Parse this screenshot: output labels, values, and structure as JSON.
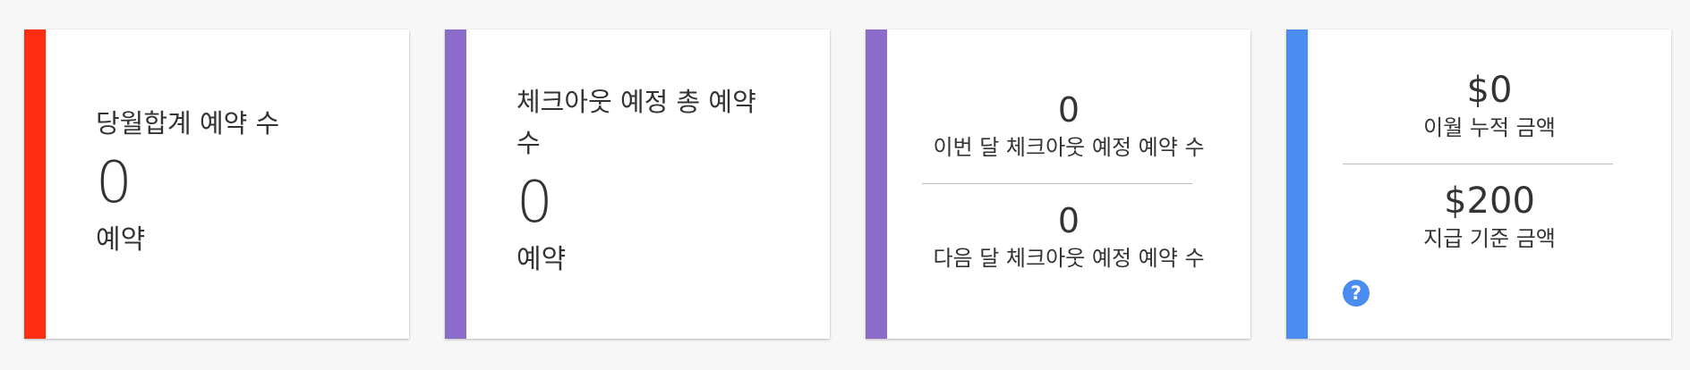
{
  "colors": {
    "card1_accent": "#ff2e12",
    "card2_accent": "#8c6ccb",
    "card3_accent": "#8c6ccb",
    "card4_accent": "#4a8cf0",
    "help_icon": "#4a8cf0"
  },
  "cards": [
    {
      "title": "당월합계 예약 수",
      "value": "0",
      "unit": "예약"
    },
    {
      "title": "체크아웃 예정 총 예약 수",
      "value": "0",
      "unit": "예약"
    },
    {
      "top_value": "0",
      "top_label": "이번 달 체크아웃 예정 예약 수",
      "bottom_value": "0",
      "bottom_label": "다음 달 체크아웃 예정 예약 수"
    },
    {
      "top_value": "$0",
      "top_label": "이월 누적 금액",
      "bottom_value": "$200",
      "bottom_label": "지급 기준 금액",
      "help_icon": "question-circle-icon"
    }
  ]
}
